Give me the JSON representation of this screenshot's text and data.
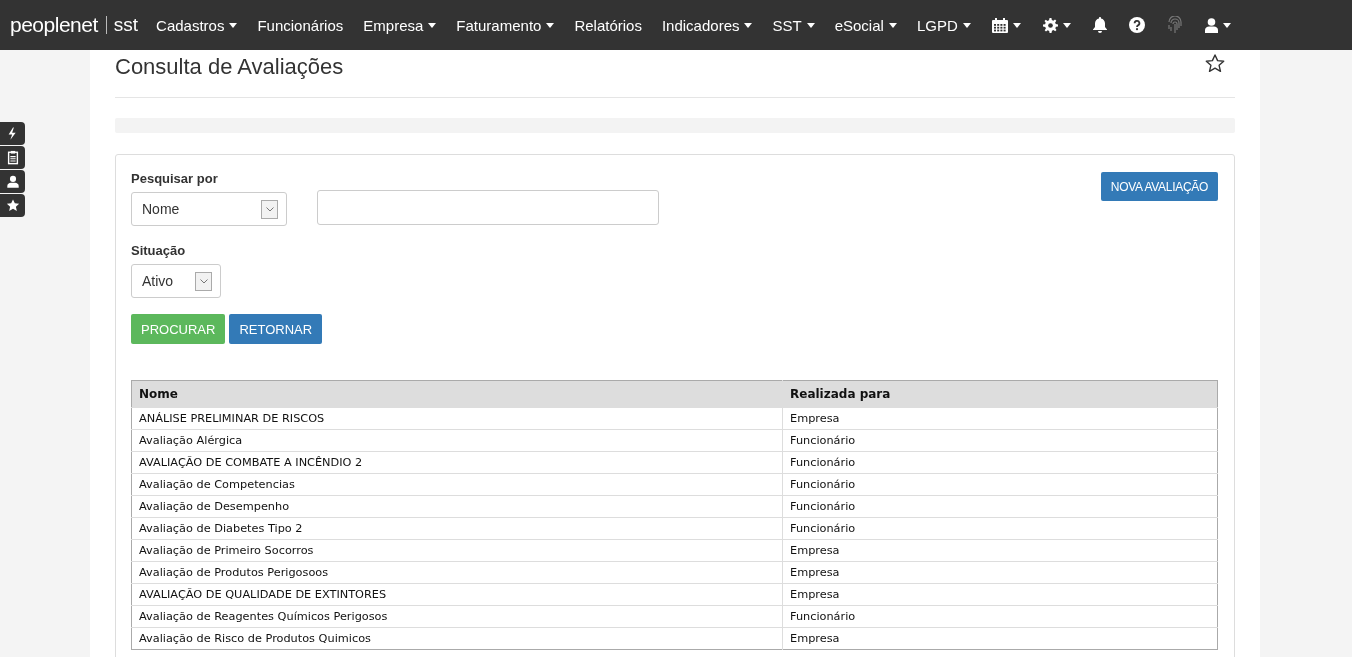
{
  "navbar": {
    "logo": {
      "brand": "peoplenet",
      "product": "sst"
    },
    "items": [
      {
        "kind": "text",
        "label": "Cadastros",
        "dropdown": true
      },
      {
        "kind": "text",
        "label": "Funcionários",
        "dropdown": false
      },
      {
        "kind": "text",
        "label": "Empresa",
        "dropdown": true
      },
      {
        "kind": "text",
        "label": "Faturamento",
        "dropdown": true
      },
      {
        "kind": "text",
        "label": "Relatórios",
        "dropdown": false
      },
      {
        "kind": "text",
        "label": "Indicadores",
        "dropdown": true
      },
      {
        "kind": "text",
        "label": "SST",
        "dropdown": true
      },
      {
        "kind": "text",
        "label": "eSocial",
        "dropdown": true
      },
      {
        "kind": "text",
        "label": "LGPD",
        "dropdown": true
      },
      {
        "kind": "calendar",
        "dropdown": true
      },
      {
        "kind": "gear",
        "dropdown": true
      },
      {
        "kind": "bell",
        "dropdown": false
      },
      {
        "kind": "help",
        "dropdown": false
      },
      {
        "kind": "fingerprint",
        "dropdown": false,
        "disabled": true
      },
      {
        "kind": "user",
        "dropdown": true
      }
    ]
  },
  "side_toolbar": [
    {
      "kind": "bolt"
    },
    {
      "kind": "clipboard"
    },
    {
      "kind": "user"
    },
    {
      "kind": "star"
    }
  ],
  "page": {
    "title": "Consulta de Avaliações",
    "favorite": false
  },
  "search": {
    "label": "Pesquisar por",
    "select_value": "Nome",
    "status_label": "Situação",
    "status_value": "Ativo",
    "new_button": "NOVA AVALIAÇÃO",
    "search_button": "PROCURAR",
    "back_button": "RETORNAR"
  },
  "table": {
    "columns": [
      "Nome",
      "Realizada para"
    ],
    "rows": [
      [
        "ANÁLISE PRELIMINAR DE RISCOS",
        "Empresa"
      ],
      [
        "Avaliação Alérgica",
        "Funcionário"
      ],
      [
        "AVALIAÇÃO DE COMBATE A INCÊNDIO 2",
        "Funcionário"
      ],
      [
        "Avaliação de Competencias",
        "Funcionário"
      ],
      [
        "Avaliação de Desempenho",
        "Funcionário"
      ],
      [
        "Avaliação de Diabetes Tipo 2",
        "Funcionário"
      ],
      [
        "Avaliação de Primeiro Socorros",
        "Empresa"
      ],
      [
        "Avaliação de Produtos Perigosoos",
        "Empresa"
      ],
      [
        "AVALIAÇÃO DE QUALIDADE DE EXTINTORES",
        "Empresa"
      ],
      [
        "Avaliação de Reagentes Químicos Perigosos",
        "Funcionário"
      ],
      [
        "Avaliação de Risco de Produtos Quimicos",
        "Empresa"
      ]
    ]
  }
}
